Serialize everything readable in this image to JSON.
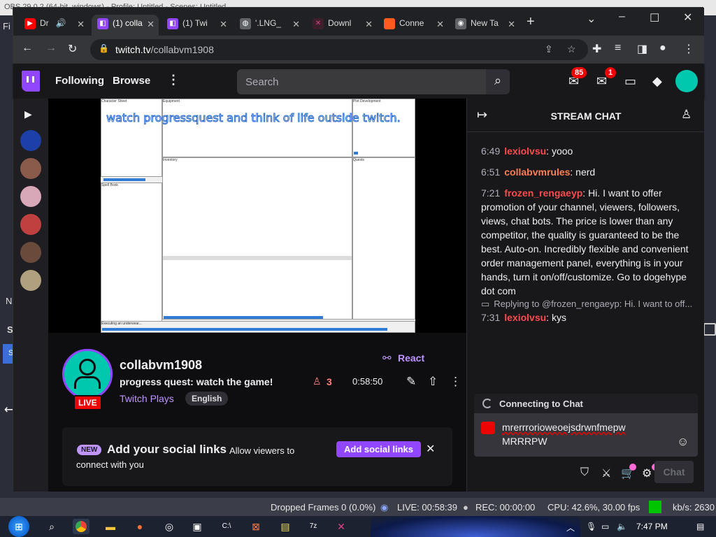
{
  "obs": {
    "title": "OBS 29.0.2 (64-bit, windows) - Profile: Untitled - Scenes: Untitled",
    "menu_letter": "Fi",
    "side_letters": [
      "N",
      "S",
      "S"
    ],
    "status": {
      "dropped": "Dropped Frames 0 (0.0%)",
      "live": "LIVE: 00:58:39",
      "rec": "REC: 00:00:00",
      "cpu": "CPU: 42.6%, 30.00 fps",
      "kbs": "kb/s: 2630"
    }
  },
  "taskbar": {
    "time": "7:47 PM"
  },
  "browser": {
    "tabs": [
      {
        "label": "Dr",
        "icon": "youtube-icon",
        "color": "#ff0000"
      },
      {
        "label": "(1) colla",
        "icon": "twitch-icon",
        "color": "#9147ff"
      },
      {
        "label": "(1) Twi",
        "icon": "twitch-icon",
        "color": "#9147ff"
      },
      {
        "label": "'.LNG_",
        "icon": "globe-icon",
        "color": "#5f6368"
      },
      {
        "label": "Downl",
        "icon": "download-site-icon",
        "color": "#a52a2a"
      },
      {
        "label": "Conne",
        "icon": "site-icon",
        "color": "#ff5a1f"
      },
      {
        "label": "New Ta",
        "icon": "chrome-icon",
        "color": "#5f6368"
      }
    ],
    "url_host": "twitch.tv",
    "url_path": "/collabvm1908"
  },
  "nav": {
    "following": "Following",
    "browse": "Browse",
    "search_placeholder": "Search",
    "notifications_count": "85",
    "inbox_count": "1"
  },
  "stream": {
    "overlay_text": "watch progressquest and think of life outside twitch.",
    "game_panels": {
      "char_sheet": "Character Sheet",
      "equipment": "Equipment",
      "plot": "Plot Development",
      "inventory": "Inventory",
      "quests": "Quests",
      "spell_book": "Spell Book",
      "status_line": "Executing an underwear..."
    }
  },
  "channel": {
    "name": "collabvm1908",
    "title": "progress quest: watch the game!",
    "category": "Twitch Plays",
    "tag": "English",
    "live_label": "LIVE",
    "react_label": "React",
    "viewers": "3",
    "uptime": "0:58:50"
  },
  "social": {
    "new_label": "NEW",
    "title": "Add your social links",
    "desc_line1": "Allow viewers to",
    "desc_line2": "connect with you",
    "button": "Add social links"
  },
  "chat": {
    "title": "STREAM CHAT",
    "messages": [
      {
        "time": "6:49",
        "user": "lexiolvsu",
        "color": "#ff4a4a",
        "text": ": yooo"
      },
      {
        "time": "6:51",
        "user": "collabvmrules",
        "color": "#ff7f50",
        "text": ": nerd"
      },
      {
        "time": "7:21",
        "user": "frozen_rengaeyp",
        "color": "#ff4a4a",
        "text": ": Hi. I want to offer promotion of your channel, viewers, followers, views, chat bots. The price is lower than any competitor, the quality is guaranteed to be the best. Auto-on. Incredibly flexible and convenient order management panel, everything is in your hands, turn it on/off/customize. Go to dogehype dot com"
      },
      {
        "time": "7:31",
        "user": "lexiolvsu",
        "color": "#ff4a4a",
        "text": ": kys"
      }
    ],
    "reply_text": "Replying to @frozen_rengaeyp: Hi. I want to off...",
    "connecting": "Connecting to Chat",
    "input_line1": "mrerrrorioweoejsdrwnfmepw",
    "input_line2": "MRRRPW",
    "send_label": "Chat"
  },
  "colors": {
    "accent": "#9147ff",
    "live_red": "#eb0400",
    "link": "#bf94ff"
  }
}
